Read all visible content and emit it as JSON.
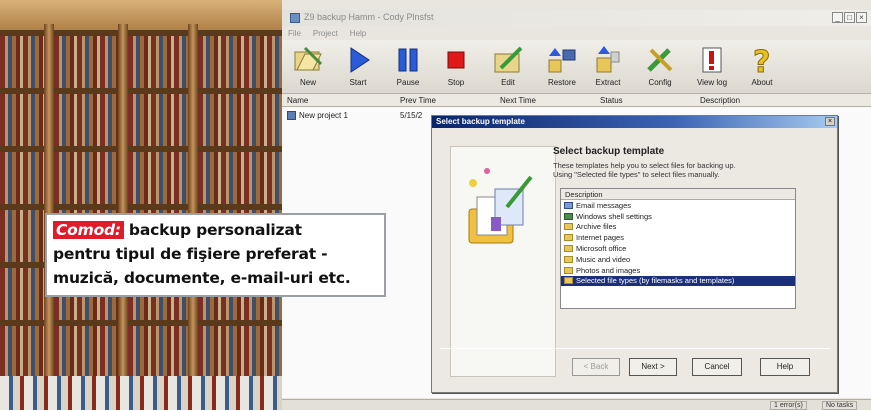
{
  "caption": {
    "brand": "Comod:",
    "line1": "backup personalizat",
    "line2": "pentru tipul de fişiere preferat -",
    "line3": "muzică, documente, e-mail-uri etc."
  },
  "window": {
    "title": "Z9 backup Hamm - Cody Plnsfst",
    "min": "_",
    "max": "□",
    "close": "×"
  },
  "menu": [
    "File",
    "Project",
    "Help"
  ],
  "toolbar": [
    {
      "label": "New",
      "icon": "new-icon"
    },
    {
      "label": "Start",
      "icon": "play-icon"
    },
    {
      "label": "Pause",
      "icon": "pause-icon"
    },
    {
      "label": "Stop",
      "icon": "stop-icon"
    },
    {
      "label": "Edit",
      "icon": "edit-icon"
    },
    {
      "label": "Restore",
      "icon": "restore-icon"
    },
    {
      "label": "Extract",
      "icon": "extract-icon"
    },
    {
      "label": "Config",
      "icon": "tools-icon"
    },
    {
      "label": "View log",
      "icon": "log-icon"
    },
    {
      "label": "About",
      "icon": "question-icon"
    }
  ],
  "columns": [
    "Name",
    "Prev Time",
    "Next Time",
    "Status",
    "Description"
  ],
  "rows": [
    {
      "name": "New project 1",
      "prev_time": "5/15/2"
    }
  ],
  "status": {
    "errors": "1 error(s)",
    "tasks": "No tasks"
  },
  "dialog": {
    "title": "Select backup template",
    "heading": "Select backup template",
    "desc_line1": "These templates help you to select files for backing up.",
    "desc_line2": "Using \"Selected file types\" to select files manually.",
    "list_header": "Description",
    "items": [
      "Email messages",
      "Windows shell settings",
      "Archive files",
      "Internet pages",
      "Microsoft office",
      "Music and video",
      "Photos and images",
      "Selected file types (by filemasks and templates)"
    ],
    "buttons": {
      "back": "< Back",
      "next": "Next >",
      "cancel": "Cancel",
      "help": "Help"
    },
    "close": "×"
  }
}
